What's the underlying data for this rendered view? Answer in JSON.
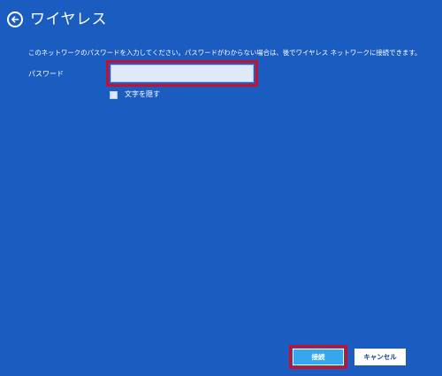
{
  "header": {
    "title": "ワイヤレス",
    "back_icon": "back-arrow-icon"
  },
  "description": "このネットワークのパスワードを入力してください。パスワードがわからない場合は、後でワイヤレス ネットワークに接続できます。",
  "password": {
    "label": "パスワード",
    "value": "",
    "highlight_color": "#c8102e"
  },
  "show_characters": {
    "label": "文字を隠す",
    "checked": false
  },
  "buttons": {
    "connect_label": "接続",
    "cancel_label": "キャンセル"
  },
  "colors": {
    "background": "#1b5cc0",
    "accent": "#36a7ee",
    "highlight": "#c8102e"
  }
}
